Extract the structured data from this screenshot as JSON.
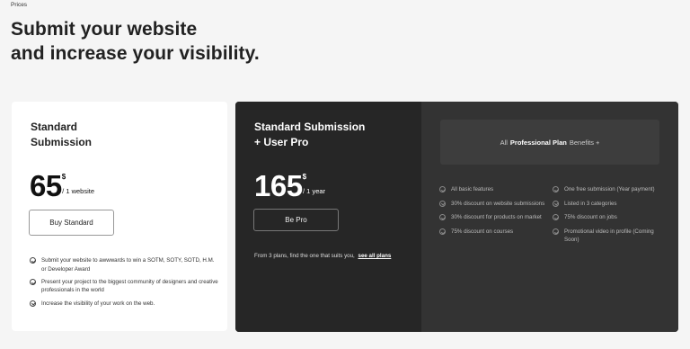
{
  "page": {
    "eyebrow": "Prices",
    "headline_line1": "Submit your website",
    "headline_line2": "and increase your visibility."
  },
  "standard": {
    "title_line1": "Standard",
    "title_line2": "Submission",
    "price": "65",
    "currency": "$",
    "per": "/ 1 website",
    "button": "Buy Standard",
    "features": [
      "Submit your website to awwwards to win a SOTM, SOTY, SOTD, H.M. or Developer Award",
      "Present your project to the biggest community of designers and creative professionals in the world",
      "Increase the visibility of your work on the web."
    ]
  },
  "pro": {
    "title_line1": "Standard Submission",
    "title_line2": "+ User Pro",
    "price": "165",
    "currency": "$",
    "per": "/ 1 year",
    "button": "Be Pro",
    "from_text": "From 3 plans, find the one that suits you,",
    "see_all": "see all plans",
    "benefits_prefix": "All",
    "benefits_bold": "Professional Plan",
    "benefits_suffix": "Benefits +",
    "benefits_col1": [
      "All basic features",
      "30% discount on website submissions",
      "30% discount for products on market",
      "75% discount on courses"
    ],
    "benefits_col2": [
      "One free submission (Year payment)",
      "Listed in 3 categories",
      "75% discount on jobs",
      "Promotional video in profile (Coming Soon)"
    ]
  },
  "colors": {
    "page_bg": "#f5f5f5",
    "dark_card": "#262626",
    "dark_panel": "#333333"
  }
}
